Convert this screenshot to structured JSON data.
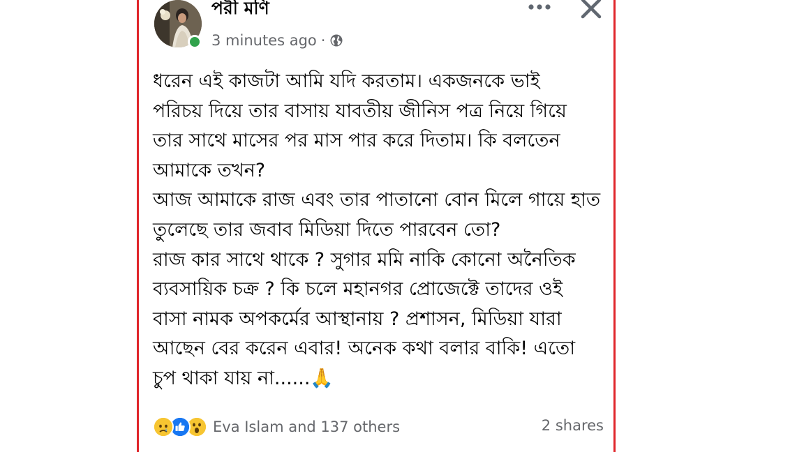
{
  "post": {
    "author": "পরী মণি",
    "time": "3 minutes ago",
    "separator": "·",
    "privacy_icon": "globe-icon",
    "paragraphs": [
      "ধরেন এই কাজটা আমি যদি করতাম। একজনকে ভাই\nপরিচয় দিয়ে তার বাসায় যাবতীয় জীনিস পত্র নিয়ে গিয়ে\nতার সাথে মাসের পর মাস পার করে দিতাম। কি বলতেন\nআমাকে তখন?",
      "আজ আমাকে রাজ এবং তার পাতানো বোন মিলে গায়ে হাত\nতুলেছে তার জবাব মিডিয়া দিতে পারবেন তো?",
      "রাজ কার সাথে থাকে ? সুগার মমি নাকি কোনো অনৈতিক\nব্যবসায়িক চক্র ? কি চলে মহানগর প্রোজেক্টে তাদের ওই\nবাসা নামক অপকর্মের আস্থানায় ? প্রশাসন, মিডিয়া যারা\nআছেন বের করেন এবার! অনেক কথা বলার বাকি! এতো\nচুপ থাকা যায় না......🙏"
    ],
    "reactions": [
      "sad",
      "like",
      "wow"
    ],
    "reaction_summary": "Eva Islam and 137 others",
    "shares": "2 shares"
  },
  "colors": {
    "border": "#e0262b",
    "online": "#31a24c",
    "meta_text": "#65676b",
    "like_blue": "#1877f2"
  }
}
